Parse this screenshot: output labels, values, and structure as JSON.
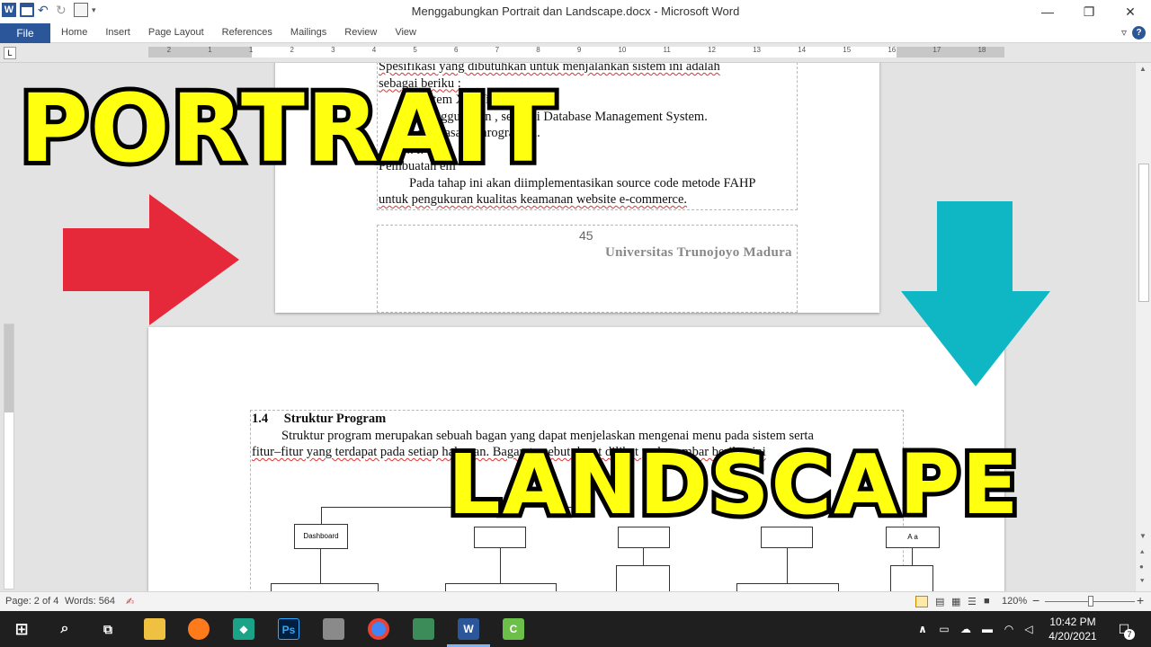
{
  "window": {
    "title": "Menggabungkan Portrait dan Landscape.docx - Microsoft Word",
    "minimize": "—",
    "restore": "❐",
    "close": "✕"
  },
  "ribbon": {
    "file_tab": "File",
    "tabs": [
      "Home",
      "Insert",
      "Page Layout",
      "References",
      "Mailings",
      "Review",
      "View"
    ]
  },
  "ruler": {
    "tab_selector": "L",
    "numbers": [
      "2",
      "1",
      "1",
      "2",
      "3",
      "4",
      "5",
      "6",
      "7",
      "8",
      "9",
      "10",
      "11",
      "12",
      "13",
      "14",
      "15",
      "16",
      "17",
      "18"
    ]
  },
  "page1": {
    "lines": [
      "Spesifikasi yang dibutuhkan untuk menjalankan sistem ini adalah",
      "sebagai beriku :",
      "1. Sistem       XP, Vista, 7, dan 8.",
      "2. Menggunakan       , sebagai Database Management System.",
      "3.         e   bahasa pemrograman.",
      "4.               r.",
      "     Pembuatan       em",
      "Pada tahap ini akan diimplementasikan source code metode FAHP",
      "untuk pengukuran kualitas keamanan website e-commerce."
    ],
    "page_number": "45",
    "footer": "Universitas Trunojoyo Madura"
  },
  "page2": {
    "heading_num": "1.4",
    "heading": "Struktur Program",
    "para1": "Struktur program merupakan sebuah bagan yang dapat menjelaskan mengenai menu pada sistem serta",
    "para2": "fitur–fitur yang terdapat pada setiap halaman. Bagan tersebut dapat dilihat pada gambar berikut ini",
    "chart_top": "Ha",
    "box_dashboard": "Dashboard",
    "box_right": "A     a"
  },
  "overlay": {
    "portrait": "PORTRAIT",
    "landscape": "LANDSCAPE",
    "arrow_right_color": "#e5283a",
    "arrow_down_color": "#0fb6c3"
  },
  "status": {
    "page": "Page: 2 of 4",
    "words": "Words: 564",
    "zoom": "120%",
    "zoom_minus": "−",
    "zoom_plus": "+"
  },
  "taskbar": {
    "time": "10:42 PM",
    "date": "4/20/2021",
    "notification_count": "7"
  }
}
